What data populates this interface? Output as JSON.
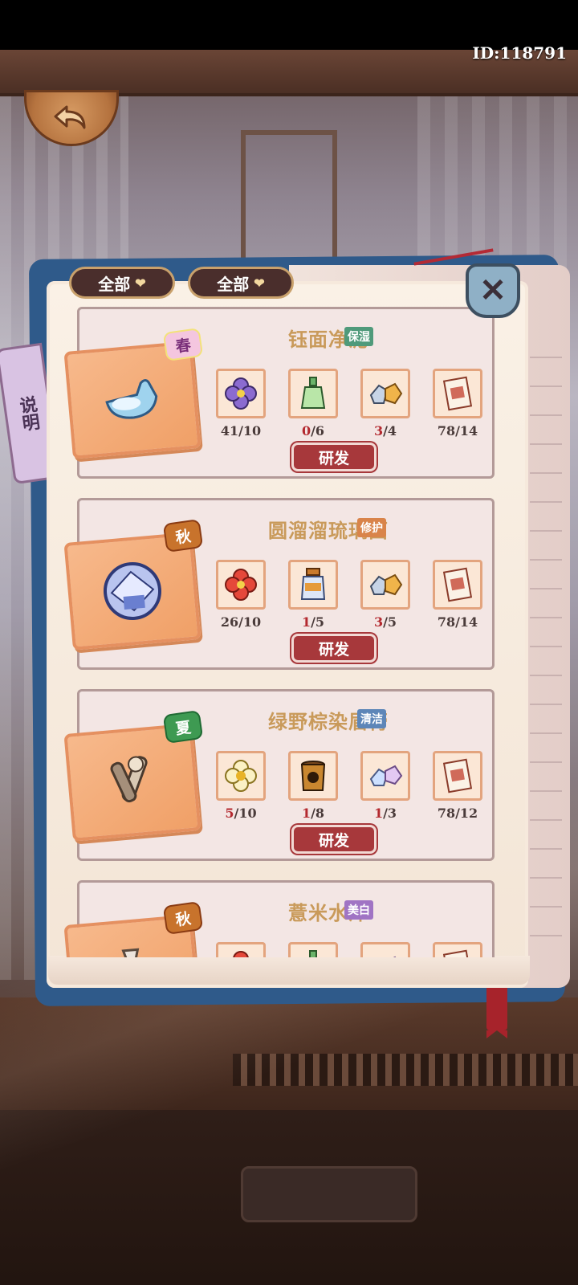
{
  "header": {
    "id_text": "ID:118791"
  },
  "filters": [
    {
      "label": "全部"
    },
    {
      "label": "全部"
    }
  ],
  "side_tab": {
    "label": "说明"
  },
  "close_label": "✕",
  "recipes": [
    {
      "title": "钰面净泥",
      "season": "春",
      "tag": "保湿",
      "tag_color": "#4f9a7a",
      "materials": [
        {
          "icon": "purple-flower-icon",
          "have": "41",
          "need": "10",
          "short": false
        },
        {
          "icon": "green-bottle-icon",
          "have": "0",
          "need": "6",
          "short": true
        },
        {
          "icon": "mineral-stone-icon",
          "have": "3",
          "need": "4",
          "short": true
        },
        {
          "icon": "recipe-scroll-icon",
          "have": "78",
          "need": "14",
          "short": false
        }
      ],
      "button": "研发"
    },
    {
      "title": "圆溜溜琉璃面",
      "season": "秋",
      "tag": "修护",
      "tag_color": "#d9844a",
      "materials": [
        {
          "icon": "red-flower-icon",
          "have": "26",
          "need": "10",
          "short": false
        },
        {
          "icon": "jar-icon",
          "have": "1",
          "need": "5",
          "short": true
        },
        {
          "icon": "mineral-stone-icon",
          "have": "3",
          "need": "5",
          "short": true
        },
        {
          "icon": "recipe-scroll-icon",
          "have": "78",
          "need": "14",
          "short": false
        }
      ],
      "button": "研发"
    },
    {
      "title": "绿野棕染眉膏",
      "season": "夏",
      "tag": "清洁",
      "tag_color": "#5d86b8",
      "materials": [
        {
          "icon": "yellow-flower-icon",
          "have": "5",
          "need": "10",
          "short": true
        },
        {
          "icon": "mud-jar-icon",
          "have": "1",
          "need": "8",
          "short": true
        },
        {
          "icon": "crystal-stone-icon",
          "have": "1",
          "need": "3",
          "short": true
        },
        {
          "icon": "recipe-scroll-icon",
          "have": "78",
          "need": "12",
          "short": false
        }
      ],
      "button": "研发"
    },
    {
      "title": "薏米水沐",
      "season": "秋",
      "tag": "美白",
      "tag_color": "#a074c4",
      "materials": [
        {
          "icon": "red-flower-icon"
        },
        {
          "icon": "green-bottle-icon"
        },
        {
          "icon": "crystal-stone-icon"
        },
        {
          "icon": "recipe-scroll-icon"
        }
      ]
    }
  ]
}
